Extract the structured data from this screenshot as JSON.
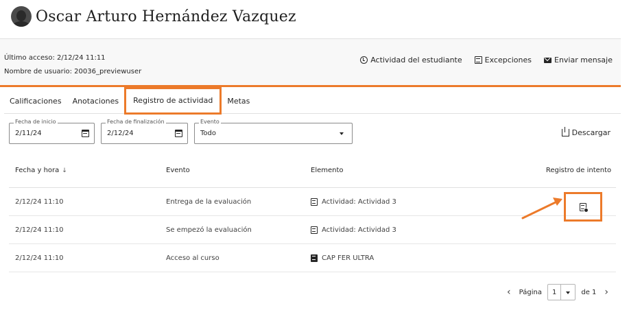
{
  "header": {
    "student_name": "Oscar Arturo Hernández Vazquez"
  },
  "info": {
    "last_access_label": "Último acceso:",
    "last_access_value": "2/12/24 11:11",
    "username_label": "Nombre de usuario:",
    "username_value": "20036_previewuser"
  },
  "actions": {
    "activity": "Actividad del estudiante",
    "exceptions": "Excepciones",
    "message": "Enviar mensaje"
  },
  "tabs": [
    {
      "label": "Calificaciones"
    },
    {
      "label": "Anotaciones"
    },
    {
      "label": "Registro de actividad"
    },
    {
      "label": "Metas"
    }
  ],
  "filters": {
    "start": {
      "label": "Fecha de inicio",
      "value": "2/11/24"
    },
    "end": {
      "label": "Fecha de finalización",
      "value": "2/12/24"
    },
    "event": {
      "label": "Evento",
      "value": "Todo"
    },
    "download": "Descargar"
  },
  "table": {
    "headers": {
      "datetime": "Fecha y hora",
      "sort_icon": "↓",
      "event": "Evento",
      "element": "Elemento",
      "attempt": "Registro de intento"
    },
    "rows": [
      {
        "datetime": "2/12/24 11:10",
        "event": "Entrega de la evaluación",
        "element": "Actividad: Actividad 3"
      },
      {
        "datetime": "2/12/24 11:10",
        "event": "Se empezó la evaluación",
        "element": "Actividad: Actividad 3"
      },
      {
        "datetime": "2/12/24 11:10",
        "event": "Acceso al curso",
        "element": "CAP FER ULTRA"
      }
    ]
  },
  "pagination": {
    "label": "Página",
    "current": "1",
    "of": "de 1",
    "prev": "‹",
    "next": "›"
  },
  "colors": {
    "accent": "#ec7a2a",
    "text": "#262626",
    "border": "#e0e0e0"
  }
}
